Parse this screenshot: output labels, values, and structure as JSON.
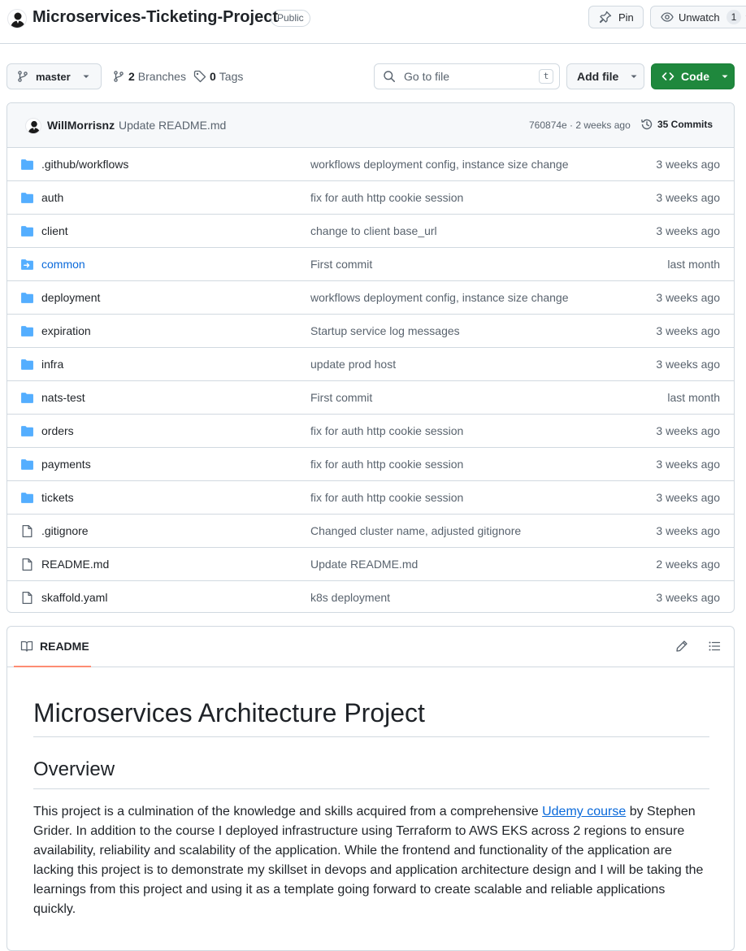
{
  "repo": {
    "name": "Microservices-Ticketing-Project",
    "visibility": "Public",
    "pin_label": "Pin",
    "unwatch_label": "Unwatch",
    "watch_count": "1"
  },
  "toolbar": {
    "branch": "master",
    "branches_count": "2",
    "branches_label": "Branches",
    "tags_count": "0",
    "tags_label": "Tags",
    "goto_placeholder": "Go to file",
    "goto_shortcut": "t",
    "add_file_label": "Add file",
    "code_label": "Code"
  },
  "latest_commit": {
    "author": "WillMorrisnz",
    "message": "Update README.md",
    "sha_time": "760874e · 2 weeks ago",
    "commits_label": "35 Commits"
  },
  "files": [
    {
      "name": ".github/workflows",
      "type": "folder",
      "message": "workflows deployment config, instance size change",
      "date": "3 weeks ago"
    },
    {
      "name": "auth",
      "type": "folder",
      "message": "fix for auth http cookie session",
      "date": "3 weeks ago"
    },
    {
      "name": "client",
      "type": "folder",
      "message": "change to client base_url",
      "date": "3 weeks ago"
    },
    {
      "name": "common",
      "type": "submodule",
      "message": "First commit",
      "date": "last month"
    },
    {
      "name": "deployment",
      "type": "folder",
      "message": "workflows deployment config, instance size change",
      "date": "3 weeks ago"
    },
    {
      "name": "expiration",
      "type": "folder",
      "message": "Startup service log messages",
      "date": "3 weeks ago"
    },
    {
      "name": "infra",
      "type": "folder",
      "message": "update prod host",
      "date": "3 weeks ago"
    },
    {
      "name": "nats-test",
      "type": "folder",
      "message": "First commit",
      "date": "last month"
    },
    {
      "name": "orders",
      "type": "folder",
      "message": "fix for auth http cookie session",
      "date": "3 weeks ago"
    },
    {
      "name": "payments",
      "type": "folder",
      "message": "fix for auth http cookie session",
      "date": "3 weeks ago"
    },
    {
      "name": "tickets",
      "type": "folder",
      "message": "fix for auth http cookie session",
      "date": "3 weeks ago"
    },
    {
      "name": ".gitignore",
      "type": "file",
      "message": "Changed cluster name, adjusted gitignore",
      "date": "3 weeks ago"
    },
    {
      "name": "README.md",
      "type": "file",
      "message": "Update README.md",
      "date": "2 weeks ago"
    },
    {
      "name": "skaffold.yaml",
      "type": "file",
      "message": "k8s deployment",
      "date": "3 weeks ago"
    }
  ],
  "readme": {
    "tab_label": "README",
    "title": "Microservices Architecture Project",
    "overview_heading": "Overview",
    "paragraph_before_link": "This project is a culmination of the knowledge and skills acquired from a comprehensive ",
    "link_text": "Udemy course",
    "paragraph_after_link": " by Stephen Grider. In addition to the course I deployed infrastructure using Terraform to AWS EKS across 2 regions to ensure availability, reliability and scalability of the application. While the frontend and functionality of the application are lacking this project is to demonstrate my skillset in devops and application architecture design and I will be taking the learnings from this project and using it as a template going forward to create scalable and reliable applications quickly."
  },
  "colors": {
    "accent_green": "#1f883d",
    "link_blue": "#0969da",
    "folder_blue": "#54aeff",
    "tab_underline": "#fd8c73"
  }
}
